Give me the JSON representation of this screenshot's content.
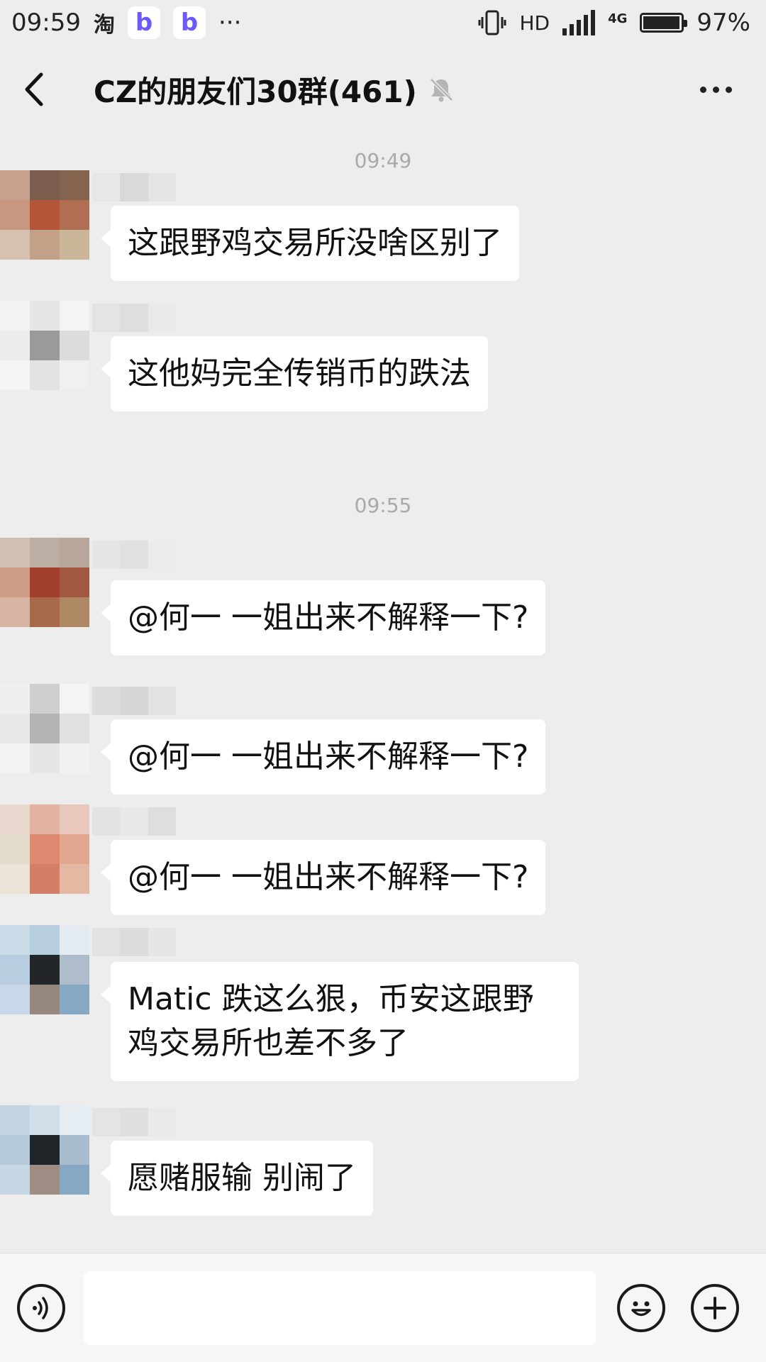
{
  "status_bar": {
    "time": "09:59",
    "taobao_glyph": "淘",
    "app_badge": "b",
    "more": "···",
    "hd": "HD",
    "network": "4G",
    "battery": "97%",
    "battery_level": 0.97
  },
  "header": {
    "title": "CZ的朋友们30群(461)"
  },
  "chat": {
    "timestamps": [
      "09:49",
      "09:55"
    ],
    "messages": [
      {
        "text": "这跟野鸡交易所没啥区别了"
      },
      {
        "text": "这他妈完全传销币的跌法"
      },
      {
        "text": "@何一  一姐出来不解释一下?"
      },
      {
        "text": "@何一  一姐出来不解释一下?"
      },
      {
        "text": "@何一  一姐出来不解释一下?"
      },
      {
        "text": "Matic 跌这么狠，币安这跟野鸡交易所也差不多了"
      },
      {
        "text": "愿赌服输 别闹了"
      }
    ]
  },
  "colors": {
    "background": "#ededed",
    "bubble": "#ffffff",
    "timestamp": "#a9a9a9"
  },
  "icons": [
    "back-icon",
    "mute-icon",
    "more-icon",
    "voice-icon",
    "emoji-icon",
    "plus-icon"
  ]
}
